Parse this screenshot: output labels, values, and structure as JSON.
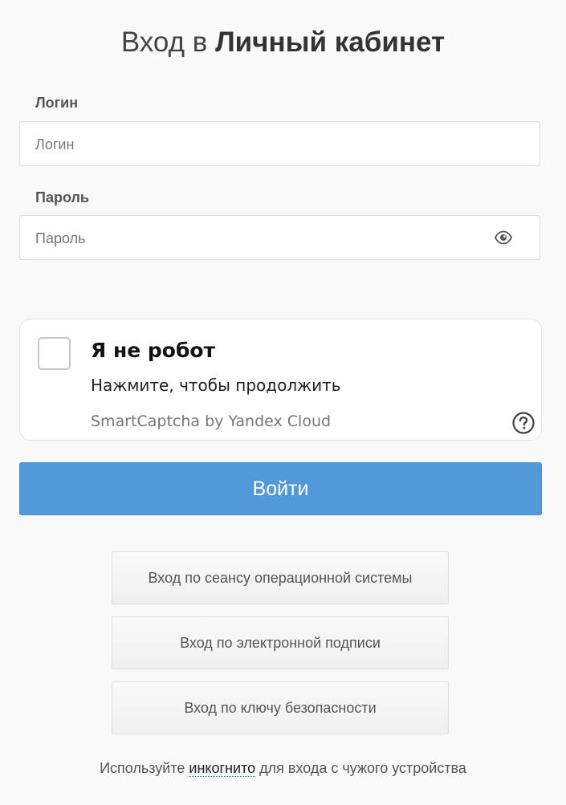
{
  "header": {
    "title_prefix": "Вход в",
    "title_bold": "Личный кабинет"
  },
  "login": {
    "label": "Логин",
    "placeholder": "Логин"
  },
  "password": {
    "label": "Пароль",
    "placeholder": "Пароль",
    "toggle_icon": "eye-icon"
  },
  "captcha": {
    "title": "Я не робот",
    "subtitle": "Нажмите, чтобы продолжить",
    "brand": "SmartCaptcha by Yandex Cloud",
    "help_icon": "question-circle-icon",
    "checked": false
  },
  "submit": {
    "label": "Войти",
    "color": "#5299da"
  },
  "alt_logins": [
    {
      "label": "Вход по сеансу операционной системы"
    },
    {
      "label": "Вход по электронной подписи"
    },
    {
      "label": "Вход по ключу безопасности"
    }
  ],
  "footer": {
    "text_before": "Используйте",
    "link": "инкогнито",
    "text_after": "для входа с чужого устройства"
  }
}
